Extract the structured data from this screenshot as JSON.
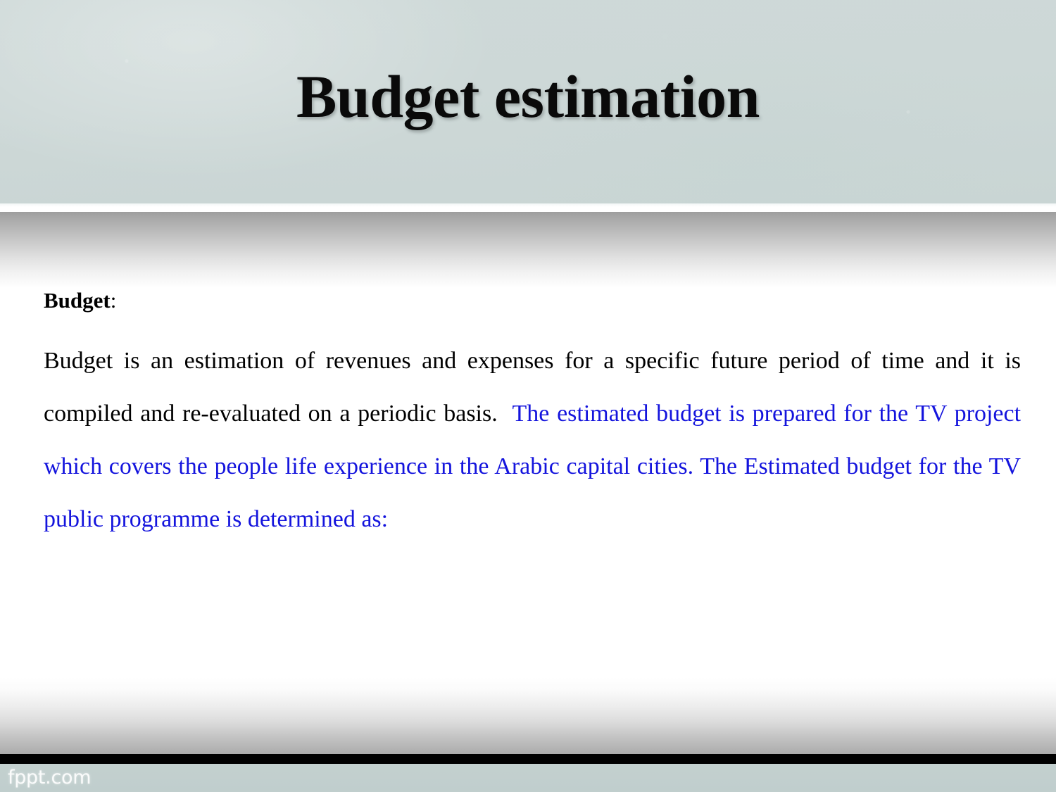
{
  "slide": {
    "title": "Budget estimation",
    "header_color": "#ccd8d8",
    "title_color": "#0a0a0a",
    "body_text_color": "#000000",
    "accent_blue": "#1414dd"
  },
  "body": {
    "lead_label_bold": "Budget",
    "lead_label_rest": ":",
    "paragraph": {
      "black_part": "Budget is an estimation of revenues and expenses for a specific future period of time and it is compiled and re-evaluated on a periodic basis.",
      "blue_part": "The estimated budget is prepared for the TV project which covers the people life experience in the Arabic capital cities. The Estimated budget for the TV public programme is determined as:"
    },
    "lines": [
      "Budget is an estimation of revenues and expenses for a specific future period of",
      "time and it is compiled and re-evaluated on a periodic basis.  The estimated budget",
      "is prepared for the TV project which covers the people life experience in the",
      "Arabic capital cities. The Estimated budget for the TV public programme is",
      "determined as:"
    ]
  },
  "footer": {
    "watermark": "fppt.com",
    "bar_color": "#000000",
    "band_color": "#c3d0cf"
  }
}
